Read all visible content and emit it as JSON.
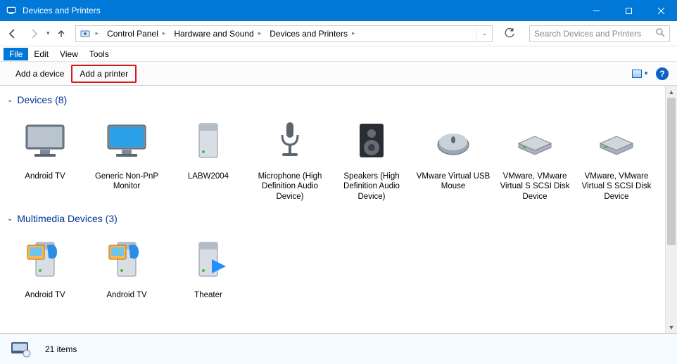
{
  "window_title": "Devices and Printers",
  "breadcrumb": [
    "Control Panel",
    "Hardware and Sound",
    "Devices and Printers"
  ],
  "search_placeholder": "Search Devices and Printers",
  "menu": {
    "file": "File",
    "edit": "Edit",
    "view": "View",
    "tools": "Tools"
  },
  "commands": {
    "add_device": "Add a device",
    "add_printer": "Add a printer"
  },
  "groups": {
    "devices": {
      "head": "Devices (8)",
      "items": [
        {
          "label": "Android TV",
          "icon": "monitor"
        },
        {
          "label": "Generic Non-PnP Monitor",
          "icon": "monitor-blue"
        },
        {
          "label": "LABW2004",
          "icon": "tower"
        },
        {
          "label": "Microphone (High Definition Audio Device)",
          "icon": "microphone"
        },
        {
          "label": "Speakers (High Definition Audio Device)",
          "icon": "speaker"
        },
        {
          "label": "VMware Virtual USB Mouse",
          "icon": "mouse"
        },
        {
          "label": "VMware, VMware Virtual S SCSI Disk Device",
          "icon": "drive"
        },
        {
          "label": "VMware, VMware Virtual S SCSI Disk Device",
          "icon": "drive"
        }
      ]
    },
    "multimedia": {
      "head": "Multimedia Devices (3)",
      "items": [
        {
          "label": "Android TV",
          "icon": "media-tower"
        },
        {
          "label": "Android TV",
          "icon": "media-tower"
        },
        {
          "label": "Theater",
          "icon": "play-tower"
        }
      ]
    }
  },
  "status": {
    "count_text": "21 items"
  },
  "help_glyph": "?"
}
